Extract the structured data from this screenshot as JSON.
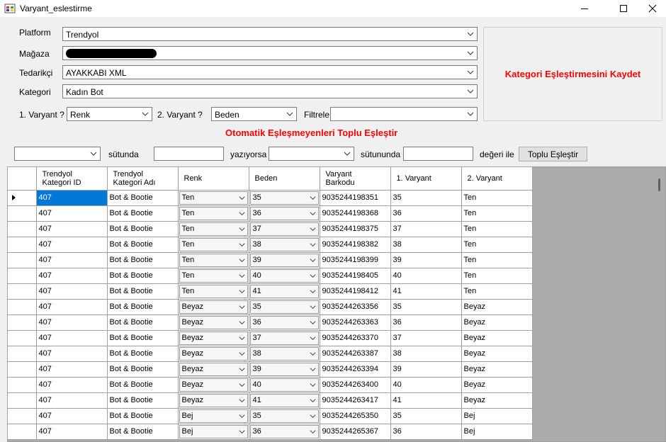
{
  "window": {
    "title": "Varyant_eslestirme"
  },
  "form": {
    "platform_label": "Platform",
    "platform_value": "Trendyol",
    "magaza_label": "Mağaza",
    "magaza_value": "",
    "tedarikci_label": "Tedarikçi",
    "tedarikci_value": "AYAKKABI XML",
    "kategori_label": "Kategori",
    "kategori_value": "Kadın Bot",
    "varyant1_label": "1. Varyant ?",
    "varyant1_value": "Renk",
    "varyant2_label": "2. Varyant ?",
    "varyant2_value": "Beden",
    "filtrele_label": "Filtrele",
    "filtrele_value": "",
    "save_button": "Kategori Eşleştirmesini Kaydet"
  },
  "bulk": {
    "title": "Otomatik Eşleşmeyenleri Toplu Eşleştir",
    "column1_value": "",
    "sutununda_label": "sütunda",
    "text1_value": "",
    "yaziyorsa_label": "yazıyorsa",
    "column2_value": "",
    "sutununda2_label": "sütununda",
    "text2_value": "",
    "degeri_ile_label": "değeri ile",
    "button": "Toplu Eşleştir"
  },
  "grid": {
    "columns": [
      "Trendyol\nKategori ID",
      "Trendyol\nKategori Adı",
      "Renk",
      "Beden",
      "Varyant\nBarkodu",
      "1. Varyant",
      "2. Varyant"
    ],
    "rows": [
      {
        "id": "407",
        "ad": "Bot & Bootie",
        "renk": "Ten",
        "beden": "35",
        "barkod": "9035244198351",
        "v1": "35",
        "v2": "Ten"
      },
      {
        "id": "407",
        "ad": "Bot & Bootie",
        "renk": "Ten",
        "beden": "36",
        "barkod": "9035244198368",
        "v1": "36",
        "v2": "Ten"
      },
      {
        "id": "407",
        "ad": "Bot & Bootie",
        "renk": "Ten",
        "beden": "37",
        "barkod": "9035244198375",
        "v1": "37",
        "v2": "Ten"
      },
      {
        "id": "407",
        "ad": "Bot & Bootie",
        "renk": "Ten",
        "beden": "38",
        "barkod": "9035244198382",
        "v1": "38",
        "v2": "Ten"
      },
      {
        "id": "407",
        "ad": "Bot & Bootie",
        "renk": "Ten",
        "beden": "39",
        "barkod": "9035244198399",
        "v1": "39",
        "v2": "Ten"
      },
      {
        "id": "407",
        "ad": "Bot & Bootie",
        "renk": "Ten",
        "beden": "40",
        "barkod": "9035244198405",
        "v1": "40",
        "v2": "Ten"
      },
      {
        "id": "407",
        "ad": "Bot & Bootie",
        "renk": "Ten",
        "beden": "41",
        "barkod": "9035244198412",
        "v1": "41",
        "v2": "Ten"
      },
      {
        "id": "407",
        "ad": "Bot & Bootie",
        "renk": "Beyaz",
        "beden": "35",
        "barkod": "9035244263356",
        "v1": "35",
        "v2": "Beyaz"
      },
      {
        "id": "407",
        "ad": "Bot & Bootie",
        "renk": "Beyaz",
        "beden": "36",
        "barkod": "9035244263363",
        "v1": "36",
        "v2": "Beyaz"
      },
      {
        "id": "407",
        "ad": "Bot & Bootie",
        "renk": "Beyaz",
        "beden": "37",
        "barkod": "9035244263370",
        "v1": "37",
        "v2": "Beyaz"
      },
      {
        "id": "407",
        "ad": "Bot & Bootie",
        "renk": "Beyaz",
        "beden": "38",
        "barkod": "9035244263387",
        "v1": "38",
        "v2": "Beyaz"
      },
      {
        "id": "407",
        "ad": "Bot & Bootie",
        "renk": "Beyaz",
        "beden": "39",
        "barkod": "9035244263394",
        "v1": "39",
        "v2": "Beyaz"
      },
      {
        "id": "407",
        "ad": "Bot & Bootie",
        "renk": "Beyaz",
        "beden": "40",
        "barkod": "9035244263400",
        "v1": "40",
        "v2": "Beyaz"
      },
      {
        "id": "407",
        "ad": "Bot & Bootie",
        "renk": "Beyaz",
        "beden": "41",
        "barkod": "9035244263417",
        "v1": "41",
        "v2": "Beyaz"
      },
      {
        "id": "407",
        "ad": "Bot & Bootie",
        "renk": "Bej",
        "beden": "35",
        "barkod": "9035244265350",
        "v1": "35",
        "v2": "Bej"
      },
      {
        "id": "407",
        "ad": "Bot & Bootie",
        "renk": "Bej",
        "beden": "36",
        "barkod": "9035244265367",
        "v1": "36",
        "v2": "Bej"
      }
    ]
  },
  "colors": {
    "accent_red": "#ff0000",
    "selection_blue": "#0078d7",
    "grid_bg": "#ababab"
  },
  "icons": {
    "app": "app-icon",
    "minimize": "minimize-icon",
    "maximize": "maximize-icon",
    "close": "close-icon",
    "dropdown": "chevron-down-icon",
    "row_indicator": "row-pointer-icon"
  }
}
